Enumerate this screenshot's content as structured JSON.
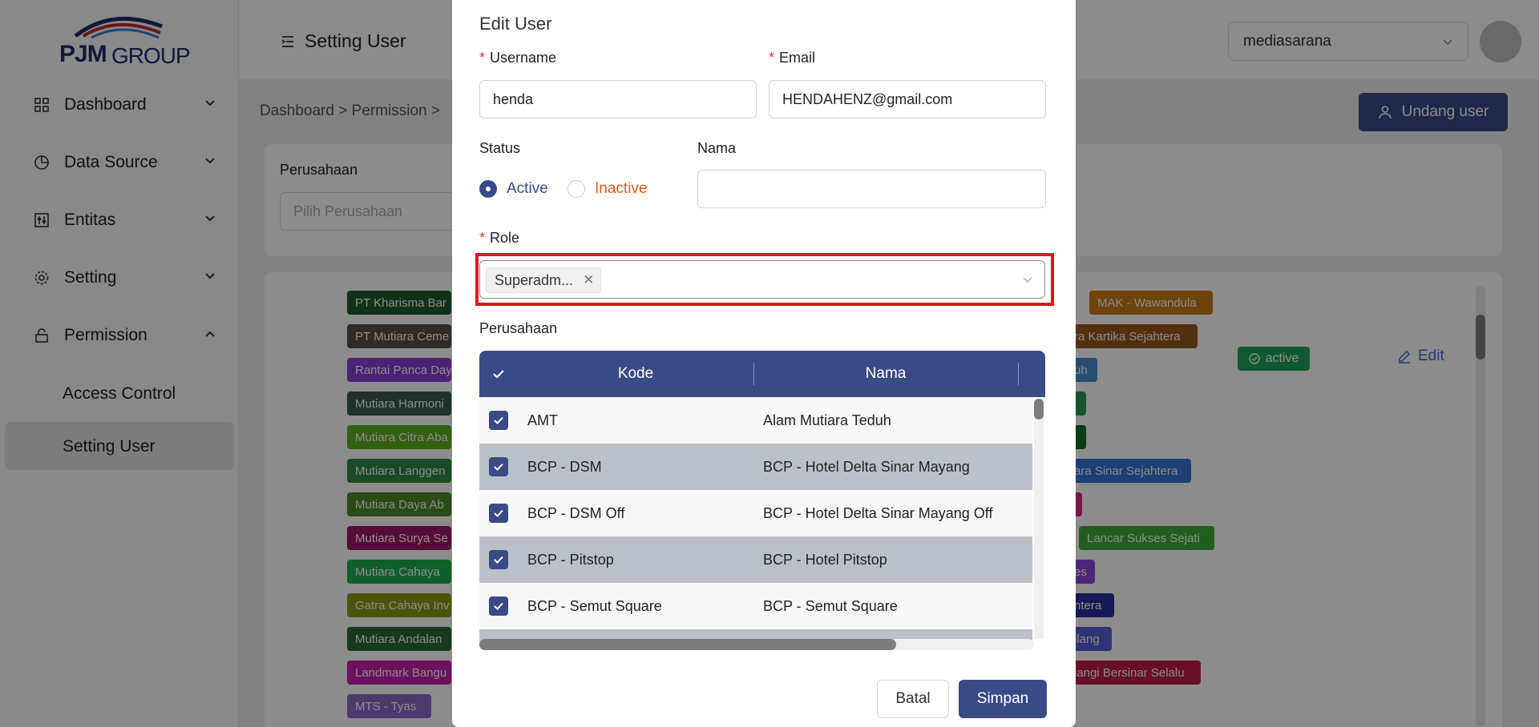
{
  "app": {
    "logo_text_bold": "PJM",
    "logo_text_light": "GROUP"
  },
  "sidebar": {
    "items": [
      {
        "label": "Dashboard",
        "icon": "grid-icon"
      },
      {
        "label": "Data Source",
        "icon": "pie-chart-icon"
      },
      {
        "label": "Entitas",
        "icon": "sliders-icon"
      },
      {
        "label": "Setting",
        "icon": "gear-icon"
      },
      {
        "label": "Permission",
        "icon": "lock-icon"
      }
    ],
    "sub_items": [
      "Access Control",
      "Setting User"
    ]
  },
  "header": {
    "title": "Setting User",
    "company": "mediasarana"
  },
  "breadcrumb": "Dashboard  >  Permission  >",
  "invite_button": "Undang user",
  "filter": {
    "label": "Perusahaan",
    "placeholder": "Pilih Perusahaan"
  },
  "background_tags": {
    "left": [
      {
        "label": "PT Kharisma Bar",
        "color": "#1f5a2c"
      },
      {
        "label": "PT Mutiara Ceme",
        "color": "#5a4e44"
      },
      {
        "label": "Rantai Panca Day",
        "color": "#8b3fd6"
      },
      {
        "label": "Mutiara Harmoni",
        "color": "#3b5c52"
      },
      {
        "label": "Mutiara Citra Aba",
        "color": "#5fb021"
      },
      {
        "label": "Mutiara Langgen",
        "color": "#2e8a46"
      },
      {
        "label": "Mutiara Daya Ab",
        "color": "#4f8a2e"
      },
      {
        "label": "Mutiara Surya Se",
        "color": "#a0156a"
      },
      {
        "label": "Mutiara Cahaya ",
        "color": "#1fae4f"
      },
      {
        "label": "Gatra Cahaya Inv",
        "color": "#8a9a12"
      },
      {
        "label": "Mutiara Andalan ",
        "color": "#2a6a34"
      },
      {
        "label": "Landmark Bangu",
        "color": "#c61fae"
      },
      {
        "label": "MTS - Tyas",
        "color": "#8b6bc9"
      }
    ],
    "right": [
      {
        "label": "MAK - Wawandula",
        "color": "#c87a17"
      },
      {
        "label": "ra Kartika Sejahtera",
        "color": "#9a5a1b"
      },
      {
        "label": "uh",
        "color": "#4a8ac9"
      },
      {
        "label": "",
        "color": "#2e9a4f"
      },
      {
        "label": "",
        "color": "#1e6a22"
      },
      {
        "label": "ara Sinar Sejahtera",
        "color": "#3a73d6"
      },
      {
        "label": "",
        "color": "#d6278a"
      },
      {
        "label": "Lancar Sukses Sejati",
        "color": "#3eae38"
      },
      {
        "label": "es",
        "color": "#8f49d6"
      },
      {
        "label": "ntera",
        "color": "#2a2f9a"
      },
      {
        "label": "ilang",
        "color": "#5660d6"
      },
      {
        "label": "langi Bersinar Selalu",
        "color": "#c01a4a"
      }
    ]
  },
  "row_status": "active",
  "row_edit": "Edit",
  "modal": {
    "title": "Edit User",
    "username_label": "Username",
    "username_value": "henda",
    "email_label": "Email",
    "email_value": "HENDAHENZ@gmail.com",
    "status_label": "Status",
    "status_active": "Active",
    "status_inactive": "Inactive",
    "nama_label": "Nama",
    "nama_value": "",
    "role_label": "Role",
    "role_tag": "Superadm...",
    "perusahaan_label": "Perusahaan",
    "table": {
      "headers": [
        "Kode",
        "Nama"
      ],
      "rows": [
        {
          "kode": "AMT",
          "nama": "Alam Mutiara Teduh"
        },
        {
          "kode": "BCP - DSM",
          "nama": "BCP - Hotel Delta Sinar Mayang"
        },
        {
          "kode": "BCP - DSM Off",
          "nama": "BCP - Hotel Delta Sinar Mayang Off"
        },
        {
          "kode": "BCP - Pitstop",
          "nama": "BCP - Hotel Pitstop"
        },
        {
          "kode": "BCP - Semut Square",
          "nama": "BCP - Semut Square"
        }
      ]
    },
    "cancel_label": "Batal",
    "save_label": "Simpan"
  },
  "colors": {
    "primary": "#3a4a85",
    "highlight": "#e0161f",
    "success": "#22a35a",
    "link": "#3a6fd8",
    "inactive": "#e85a12"
  }
}
